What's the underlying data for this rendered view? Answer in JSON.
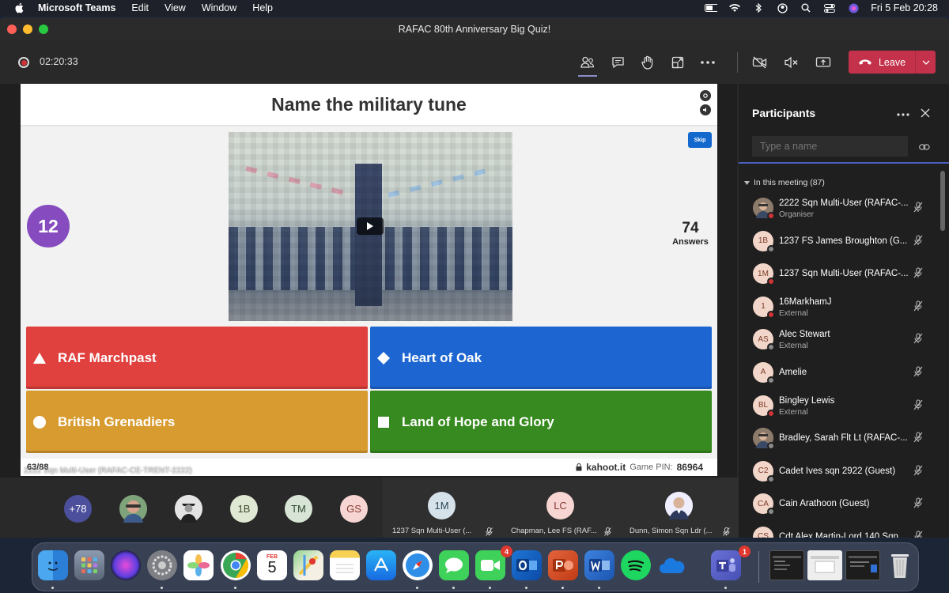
{
  "menubar": {
    "app_name": "Microsoft Teams",
    "items": [
      "Edit",
      "View",
      "Window",
      "Help"
    ],
    "clock": "Fri 5 Feb  20:28"
  },
  "window": {
    "title": "RAFAC 80th Anniversary Big Quiz!"
  },
  "meeting": {
    "elapsed": "02:20:33",
    "leave_label": "Leave"
  },
  "slide": {
    "question": "Name the military tune",
    "skip_label": "Skip",
    "timer_value": "12",
    "answers_count": "74",
    "answers_label": "Answers",
    "options": [
      {
        "label": "RAF Marchpast",
        "shape": "triangle",
        "color": "#e0403e"
      },
      {
        "label": "Heart of Oak",
        "shape": "diamond",
        "color": "#1d66d1"
      },
      {
        "label": "British Grenadiers",
        "shape": "circle",
        "color": "#d89b30"
      },
      {
        "label": "Land of Hope and Glory",
        "shape": "square",
        "color": "#378a1f"
      }
    ],
    "question_counter": "63/88",
    "site": "kahoot.it",
    "pin_label": "Game PIN:",
    "pin": "86964",
    "presenter": "2222 Sqn Multi-User (RAFAC-CE-TRENT-2222)"
  },
  "participants": {
    "title": "Participants",
    "search_placeholder": "Type a name",
    "section": "In this meeting (87)",
    "list": [
      {
        "initials": "",
        "name": "2222 Sqn Multi-User (RAFAC-...",
        "role": "Organiser",
        "photo": true,
        "status": "busy"
      },
      {
        "initials": "1B",
        "name": "1237 FS James Broughton (G...",
        "role": "",
        "photo": false,
        "status": "away"
      },
      {
        "initials": "1M",
        "name": "1237 Sqn Multi-User (RAFAC-...",
        "role": "",
        "photo": false,
        "status": "busy"
      },
      {
        "initials": "1",
        "name": "16MarkhamJ",
        "role": "External",
        "photo": false,
        "status": "busy"
      },
      {
        "initials": "AS",
        "name": "Alec Stewart",
        "role": "External",
        "photo": false,
        "status": "away"
      },
      {
        "initials": "A",
        "name": "Amelie",
        "role": "",
        "photo": false,
        "status": "away"
      },
      {
        "initials": "BL",
        "name": "Bingley Lewis",
        "role": "External",
        "photo": false,
        "status": "busy"
      },
      {
        "initials": "",
        "name": "Bradley, Sarah Flt Lt (RAFAC-...",
        "role": "",
        "photo": true,
        "status": "away"
      },
      {
        "initials": "C2",
        "name": "Cadet Ives sqn 2922 (Guest)",
        "role": "",
        "photo": false,
        "status": "away"
      },
      {
        "initials": "CA",
        "name": "Cain Arathoon (Guest)",
        "role": "",
        "photo": false,
        "status": "away"
      },
      {
        "initials": "CS",
        "name": "Cdt Alex Martin-Lord 140 Sqn...",
        "role": "",
        "photo": false,
        "status": "away"
      }
    ]
  },
  "gallery": {
    "overflow": "+78",
    "avatars": [
      {
        "initials": "",
        "photo": "person"
      },
      {
        "initials": "",
        "photo": "uniform"
      },
      {
        "initials": "1B",
        "photo": ""
      },
      {
        "initials": "TM",
        "photo": ""
      },
      {
        "initials": "GS",
        "photo": ""
      }
    ],
    "tiles": [
      {
        "initials": "1M",
        "name": "1237 Sqn Multi-User (..."
      },
      {
        "initials": "LC",
        "name": "Chapman, Lee FS (RAF..."
      },
      {
        "initials": "",
        "name": "Dunn, Simon Sqn Ldr (..."
      }
    ]
  },
  "dock": {
    "calendar_month": "FEB",
    "calendar_day": "5",
    "facetime_badge": "4",
    "teams_badge": "1"
  }
}
